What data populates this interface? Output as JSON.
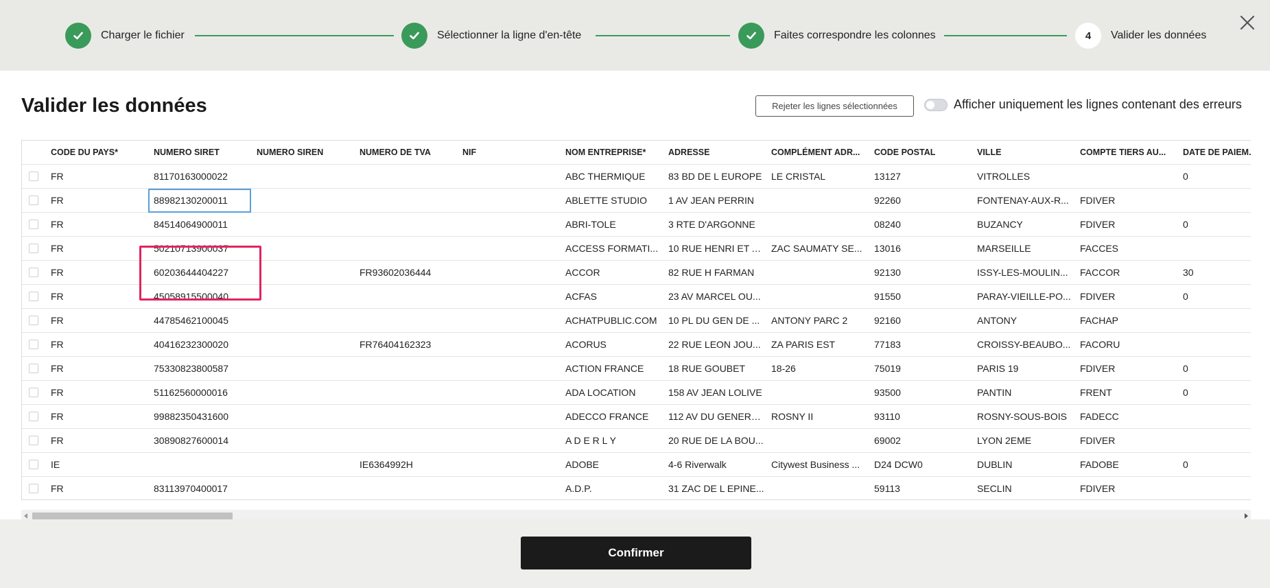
{
  "stepper": {
    "steps": [
      {
        "label": "Charger le fichier",
        "status": "done"
      },
      {
        "label": "Sélectionner la ligne d'en-tête",
        "status": "done"
      },
      {
        "label": "Faites correspondre les colonnes",
        "status": "done"
      },
      {
        "label": "Valider les données",
        "status": "current",
        "number": "4"
      }
    ],
    "close_icon": "close-icon"
  },
  "main": {
    "title": "Valider les données",
    "reject_button": "Rejeter les lignes sélectionnées",
    "toggle": {
      "label": "Afficher uniquement les lignes contenant des erreurs",
      "on": false
    }
  },
  "table": {
    "columns": [
      "CODE DU PAYS*",
      "NUMERO SIRET",
      "NUMERO SIREN",
      "NUMERO DE TVA",
      "NIF",
      "NOM ENTREPRISE*",
      "ADRESSE",
      "COMPLÉMENT ADR...",
      "CODE POSTAL",
      "VILLE",
      "COMPTE TIERS AU...",
      "DATE DE PAIEM..."
    ],
    "rows": [
      [
        "FR",
        "81170163000022",
        "",
        "",
        "",
        "ABC THERMIQUE",
        "83 BD DE L EUROPE",
        "LE CRISTAL",
        "13127",
        "VITROLLES",
        "",
        "0"
      ],
      [
        "FR",
        "88982130200011",
        "",
        "",
        "",
        "ABLETTE STUDIO",
        "1 AV JEAN PERRIN",
        "",
        "92260",
        "FONTENAY-AUX-R...",
        "FDIVER",
        ""
      ],
      [
        "FR",
        "84514064900011",
        "",
        "",
        "",
        "ABRI-TOLE",
        "3 RTE D'ARGONNE",
        "",
        "08240",
        "BUZANCY",
        "FDIVER",
        "0"
      ],
      [
        "FR",
        "50210713900037",
        "",
        "",
        "",
        "ACCESS FORMATI...",
        "10 RUE HENRI ET A...",
        "ZAC SAUMATY SE...",
        "13016",
        "MARSEILLE",
        "FACCES",
        ""
      ],
      [
        "FR",
        "60203644404227",
        "",
        "FR93602036444",
        "",
        "ACCOR",
        "82 RUE H FARMAN",
        "",
        "92130",
        "ISSY-LES-MOULIN...",
        "FACCOR",
        "30"
      ],
      [
        "FR",
        "45058915500040",
        "",
        "",
        "",
        "ACFAS",
        "23 AV MARCEL OU...",
        "",
        "91550",
        "PARAY-VIEILLE-PO...",
        "FDIVER",
        "0"
      ],
      [
        "FR",
        "44785462100045",
        "",
        "",
        "",
        "ACHATPUBLIC.COM",
        "10 PL DU GEN DE ...",
        "ANTONY PARC 2",
        "92160",
        "ANTONY",
        "FACHAP",
        ""
      ],
      [
        "FR",
        "40416232300020",
        "",
        "FR76404162323",
        "",
        "ACORUS",
        "22 RUE LEON JOU...",
        "ZA PARIS EST",
        "77183",
        "CROISSY-BEAUBO...",
        "FACORU",
        ""
      ],
      [
        "FR",
        "75330823800587",
        "",
        "",
        "",
        "ACTION FRANCE",
        "18 RUE GOUBET",
        "18-26",
        "75019",
        "PARIS 19",
        "FDIVER",
        "0"
      ],
      [
        "FR",
        "51162560000016",
        "",
        "",
        "",
        "ADA LOCATION",
        "158 AV JEAN LOLIVE",
        "",
        "93500",
        "PANTIN",
        "FRENT",
        "0"
      ],
      [
        "FR",
        "99882350431600",
        "",
        "",
        "",
        "ADECCO FRANCE",
        "112 AV DU GENERA...",
        "ROSNY II",
        "93110",
        "ROSNY-SOUS-BOIS",
        "FADECC",
        ""
      ],
      [
        "FR",
        "30890827600014",
        "",
        "",
        "",
        "A D E R L Y",
        "20 RUE DE LA BOU...",
        "",
        "69002",
        "LYON 2EME",
        "FDIVER",
        ""
      ],
      [
        "IE",
        "",
        "",
        "IE6364992H",
        "",
        "ADOBE",
        "4-6 Riverwalk",
        "Citywest Business ...",
        "D24 DCW0",
        "DUBLIN",
        "FADOBE",
        "0"
      ],
      [
        "FR",
        "83113970400017",
        "",
        "",
        "",
        "A.D.P.",
        "31 ZAC DE L EPINE...",
        "",
        "59113",
        "SECLIN",
        "FDIVER",
        ""
      ]
    ],
    "active_cell": {
      "row": 1,
      "col": 1
    }
  },
  "footer": {
    "confirm_button": "Confirmer"
  },
  "colors": {
    "success": "#3a9a5a",
    "highlight": "#e0245e",
    "focus": "#5a9fd8",
    "primary_button": "#1b1b1b"
  }
}
